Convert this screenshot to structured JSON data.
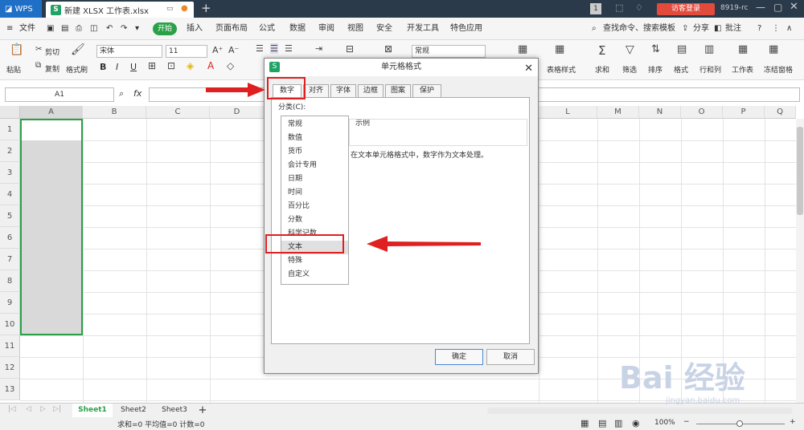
{
  "titlebar": {
    "app": "WPS",
    "doc": "新建 XLSX 工作表.xlsx",
    "tab_add": "+",
    "page_num": "1",
    "login": "访客登录",
    "user": "8919-rc"
  },
  "menu": {
    "file": "文件",
    "start": "开始",
    "items": [
      "插入",
      "页面布局",
      "公式",
      "数据",
      "审阅",
      "视图",
      "安全",
      "开发工具",
      "特色应用"
    ],
    "search": "查找命令、搜索模板",
    "share": "分享",
    "comment": "批注",
    "help": "?"
  },
  "ribbon": {
    "paste": "粘贴",
    "cut": "剪切",
    "copy": "复制",
    "brush": "格式刷",
    "font": "宋体",
    "size": "11",
    "format": "常规",
    "table_style": "表格样式",
    "sum": "求和",
    "filter": "筛选",
    "sort": "排序",
    "fmt": "格式",
    "rowcol": "行和列",
    "sheet": "工作表",
    "freeze": "冻结窗格",
    "bold": "B",
    "italic": "I",
    "underline": "U"
  },
  "formula": {
    "cell": "A1",
    "fx": "fx"
  },
  "columns": [
    "A",
    "B",
    "C",
    "D",
    "L",
    "M",
    "N",
    "O",
    "P",
    "Q"
  ],
  "rows": [
    "1",
    "2",
    "3",
    "4",
    "5",
    "6",
    "7",
    "8",
    "9",
    "10",
    "11",
    "12",
    "13"
  ],
  "sheets": {
    "tabs": [
      "Sheet1",
      "Sheet2",
      "Sheet3"
    ],
    "add": "+"
  },
  "status": {
    "text": "求和=0  平均值=0  计数=0",
    "zoom": "100%"
  },
  "dialog": {
    "title": "单元格格式",
    "tabs": [
      "数字",
      "对齐",
      "字体",
      "边框",
      "图案",
      "保护"
    ],
    "category_label": "分类(C):",
    "categories": [
      "常规",
      "数值",
      "货币",
      "会计专用",
      "日期",
      "时间",
      "百分比",
      "分数",
      "科学记数",
      "文本",
      "特殊",
      "自定义"
    ],
    "sample_label": "示例",
    "description": "在文本单元格格式中，数字作为文本处理。",
    "ok": "确定",
    "cancel": "取消"
  },
  "watermark": {
    "main": "Bai 经验",
    "sub": "jingyan.baidu.com"
  },
  "colors": {
    "accent": "#2aa148",
    "highlight": "#e02020",
    "selection": "#d9d9d9"
  }
}
